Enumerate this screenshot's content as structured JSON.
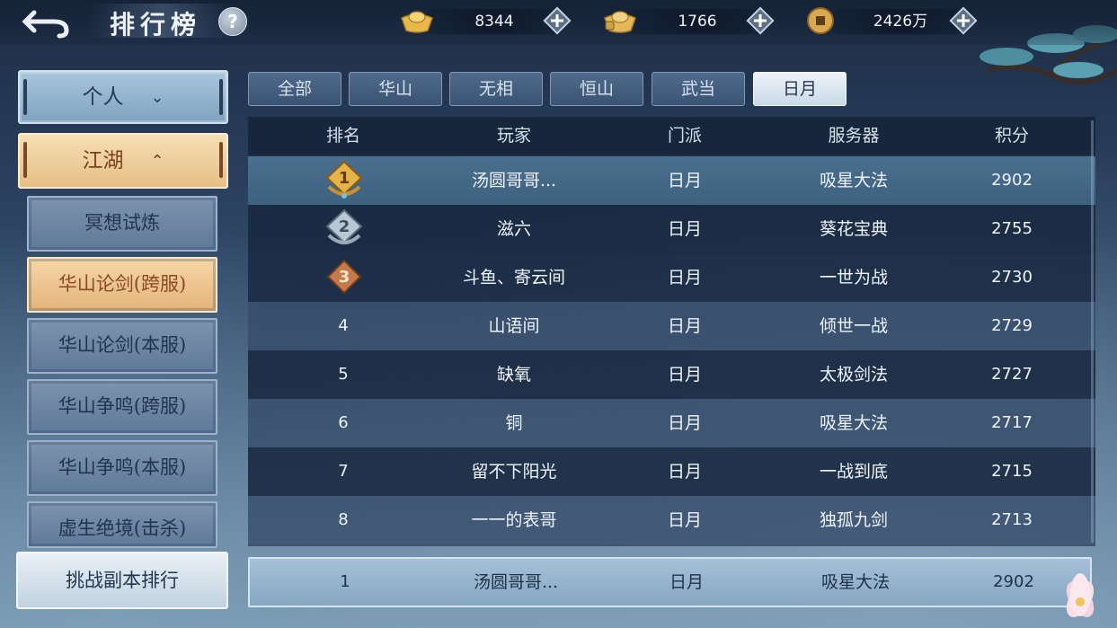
{
  "header": {
    "title": "排行榜",
    "help": "?"
  },
  "currencies": [
    {
      "icon": "gold-ingot-icon",
      "value": "8344"
    },
    {
      "icon": "bound-ingot-icon",
      "value": "1766"
    },
    {
      "icon": "copper-coin-icon",
      "value": "2426万"
    }
  ],
  "nav": {
    "personal": "个人",
    "jianghu": "江湖",
    "sub_items": [
      "冥想试炼",
      "华山论剑(跨服)",
      "华山论剑(本服)",
      "华山争鸣(跨服)",
      "华山争鸣(本服)",
      "虚生绝境(击杀)"
    ],
    "active_sub": 1,
    "challenge": "挑战副本排行"
  },
  "tabs": [
    "全部",
    "华山",
    "无相",
    "恒山",
    "武当",
    "日月"
  ],
  "active_tab": 5,
  "table": {
    "headers": {
      "rank": "排名",
      "player": "玩家",
      "school": "门派",
      "server": "服务器",
      "score": "积分"
    },
    "rows": [
      {
        "rank": "1",
        "player": "汤圆哥哥...",
        "school": "日月",
        "server": "吸星大法",
        "score": "2902"
      },
      {
        "rank": "2",
        "player": "滋六",
        "school": "日月",
        "server": "葵花宝典",
        "score": "2755"
      },
      {
        "rank": "3",
        "player": "斗鱼、寄云间",
        "school": "日月",
        "server": "一世为战",
        "score": "2730"
      },
      {
        "rank": "4",
        "player": "山语间",
        "school": "日月",
        "server": "倾世一战",
        "score": "2729"
      },
      {
        "rank": "5",
        "player": "缺氧",
        "school": "日月",
        "server": "太极剑法",
        "score": "2727"
      },
      {
        "rank": "6",
        "player": "铜",
        "school": "日月",
        "server": "吸星大法",
        "score": "2717"
      },
      {
        "rank": "7",
        "player": "留不下阳光",
        "school": "日月",
        "server": "一战到底",
        "score": "2715"
      },
      {
        "rank": "8",
        "player": "一一的表哥",
        "school": "日月",
        "server": "独孤九剑",
        "score": "2713"
      }
    ]
  },
  "my_rank": {
    "rank": "1",
    "player": "汤圆哥哥...",
    "school": "日月",
    "server": "吸星大法",
    "score": "2902"
  },
  "colors": {
    "accent_gold": "#e6bf85",
    "active_tab": "#c9d9e7",
    "row_highlight": "#4b6f8e"
  }
}
